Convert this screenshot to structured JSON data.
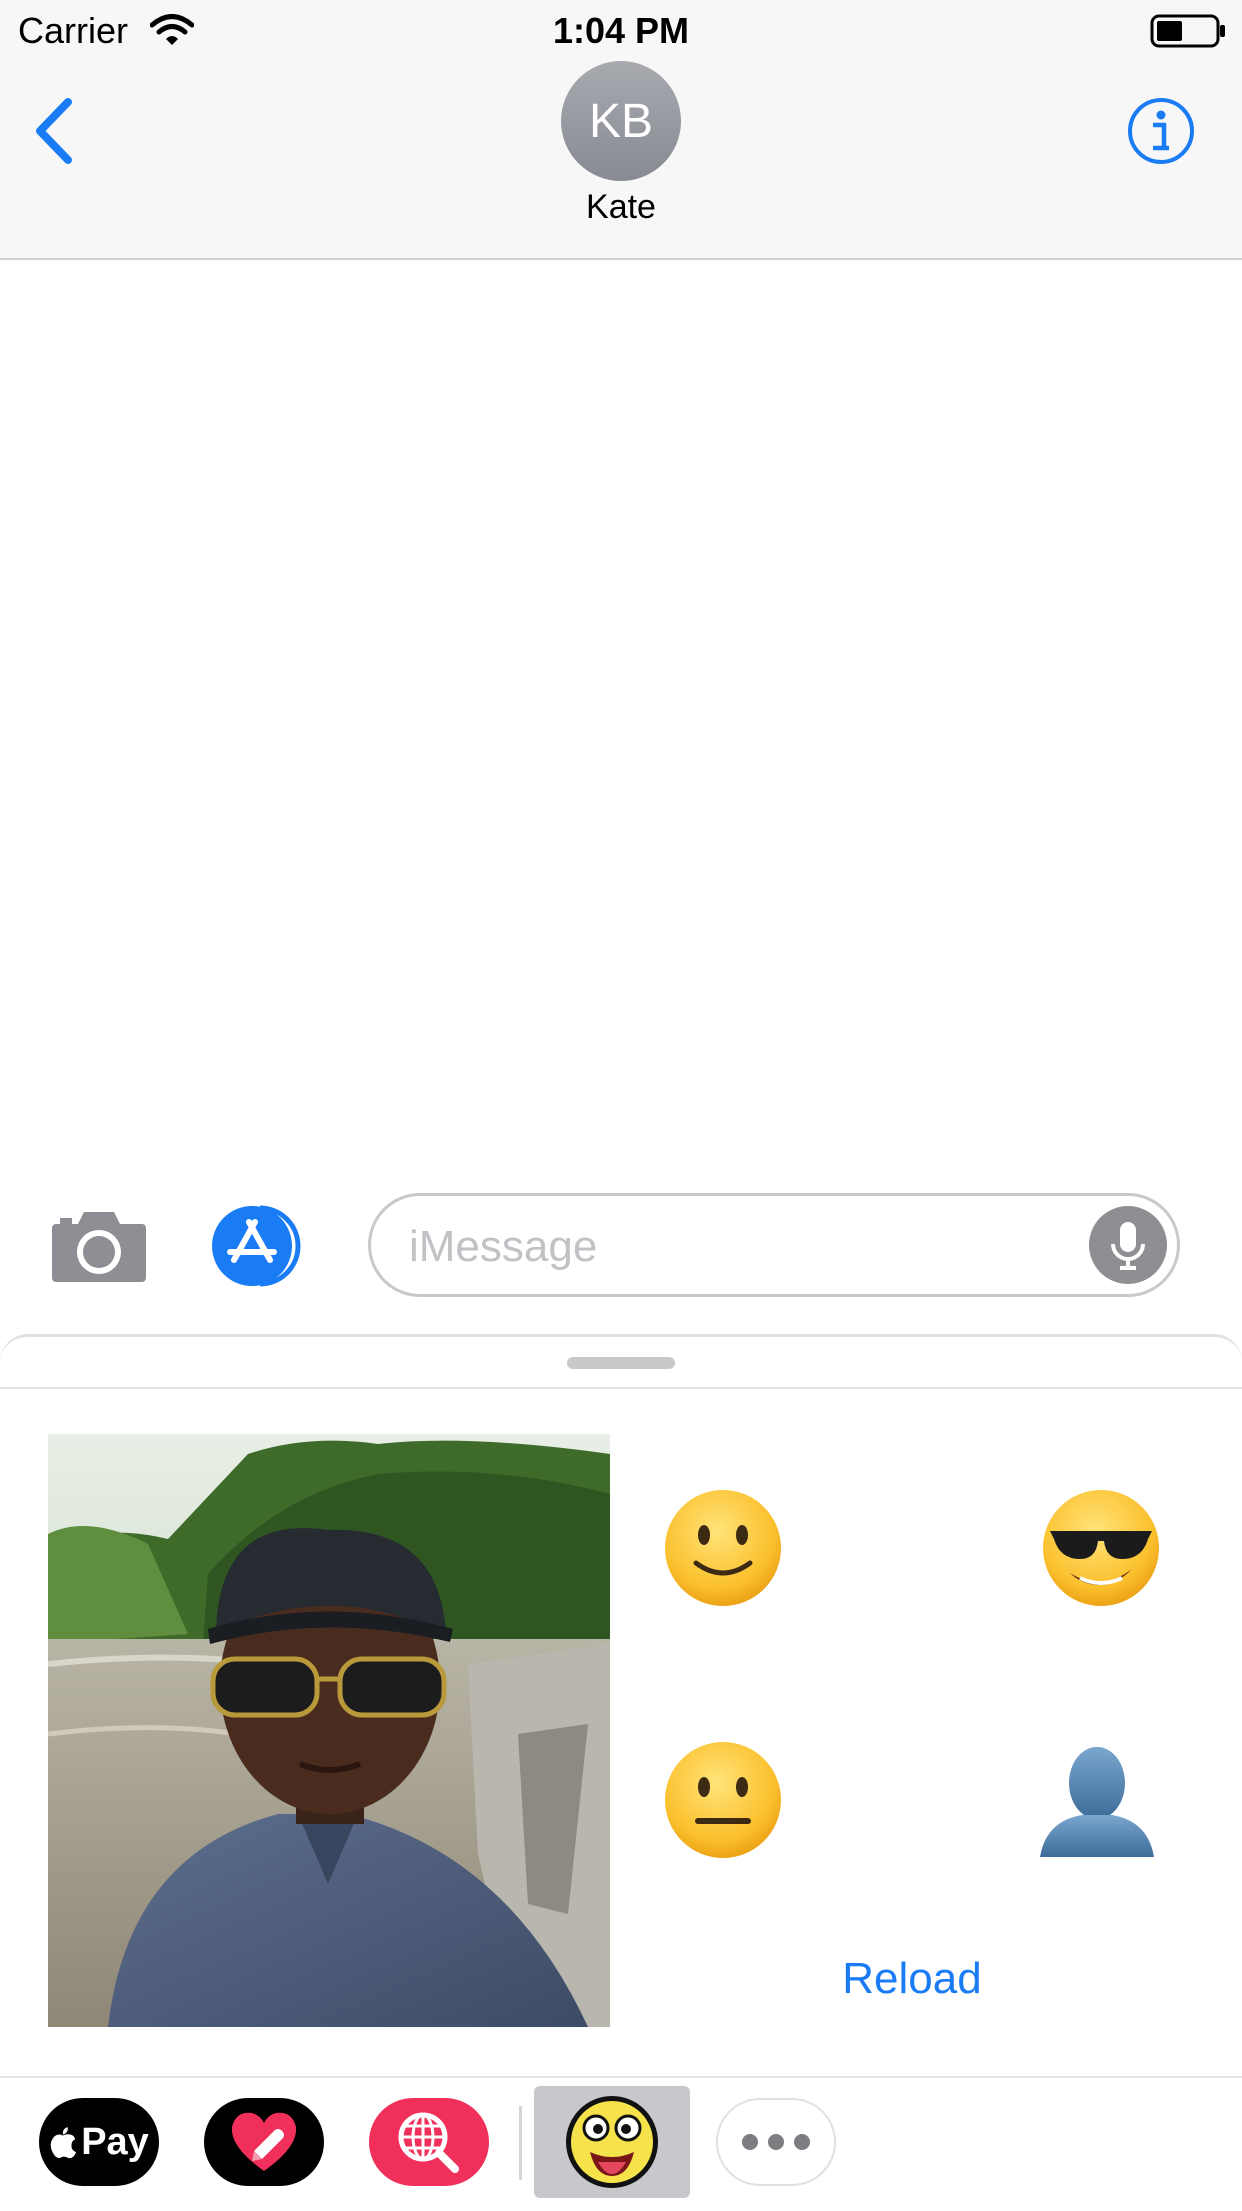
{
  "status_bar": {
    "carrier": "Carrier",
    "time": "1:04 PM",
    "battery_level": 0.45
  },
  "nav": {
    "contact_initials": "KB",
    "contact_name": "Kate"
  },
  "composer": {
    "placeholder": "iMessage"
  },
  "drawer": {
    "emojis": [
      {
        "name": "slightly-smiling-face",
        "glyph": "🙂"
      },
      {
        "name": "sunglasses-face",
        "glyph": "😎"
      },
      {
        "name": "neutral-face",
        "glyph": "😐"
      },
      {
        "name": "bust-in-silhouette",
        "glyph": "👤"
      }
    ],
    "reload_label": "Reload"
  },
  "app_strip": {
    "apple_pay_label": "Pay",
    "apps": [
      "apple-pay",
      "digital-touch",
      "image-search",
      "emoji-sticker-app",
      "more"
    ]
  },
  "colors": {
    "accent": "#1a7cf5",
    "search_app": "#f0305a",
    "avatar_gray": "#8e8e93"
  }
}
